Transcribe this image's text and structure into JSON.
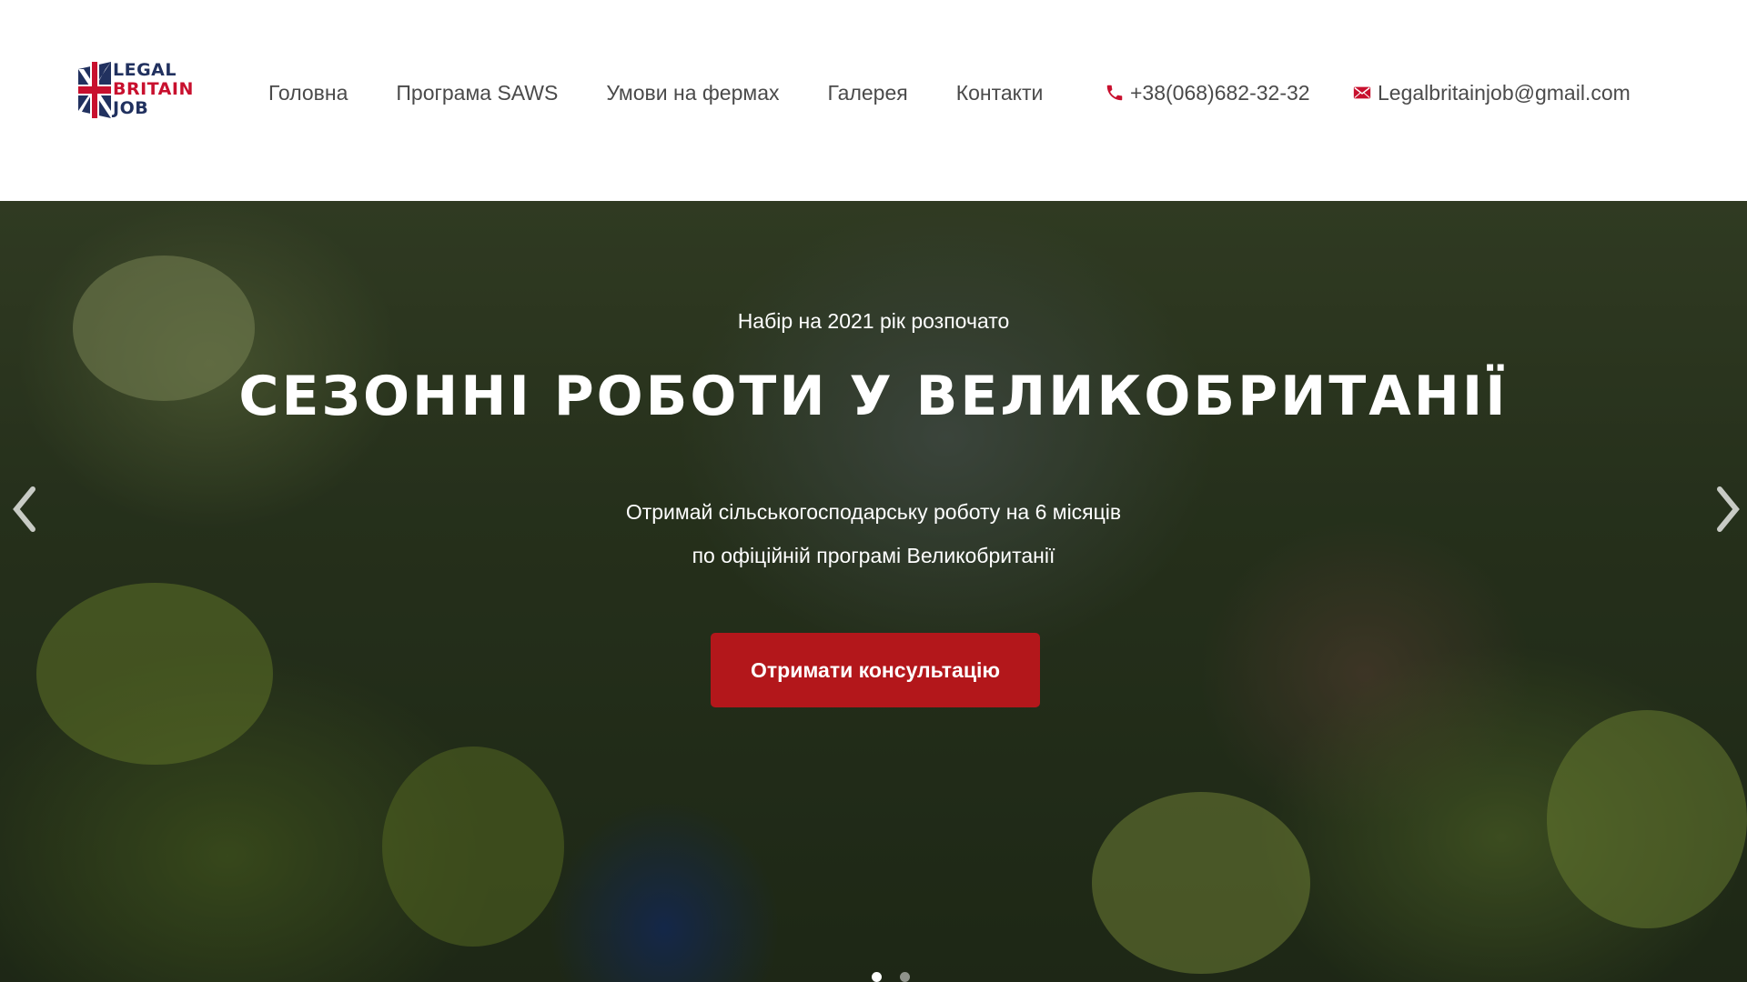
{
  "logo": {
    "line1": "LEGAL",
    "line2": "BRITAIN",
    "line3": "JOB"
  },
  "nav": {
    "items": [
      {
        "label": "Головна"
      },
      {
        "label": "Програма SAWS"
      },
      {
        "label": "Умови на фермах"
      },
      {
        "label": "Галерея"
      },
      {
        "label": "Контакти"
      }
    ]
  },
  "contacts": {
    "phone": "+38(068)682-32-32",
    "email": "Legalbritainjob@gmail.com",
    "icon_color": "#c8102e"
  },
  "hero": {
    "subtitle": "Набір на 2021 рік розпочато",
    "title": "СЕЗОННІ РОБОТИ У ВЕЛИКОБРИТАНІЇ",
    "desc_line1": "Отримай сільськогосподарську роботу на 6 місяців",
    "desc_line2": "по офіційній програмі Великобританії",
    "cta_label": "Отримати консультацію",
    "cta_color": "#b3171b",
    "slides_total": 2,
    "active_slide": 1
  },
  "icons": {
    "phone": "phone-icon",
    "email": "envelope-icon",
    "prev": "chevron-left-icon",
    "next": "chevron-right-icon"
  }
}
